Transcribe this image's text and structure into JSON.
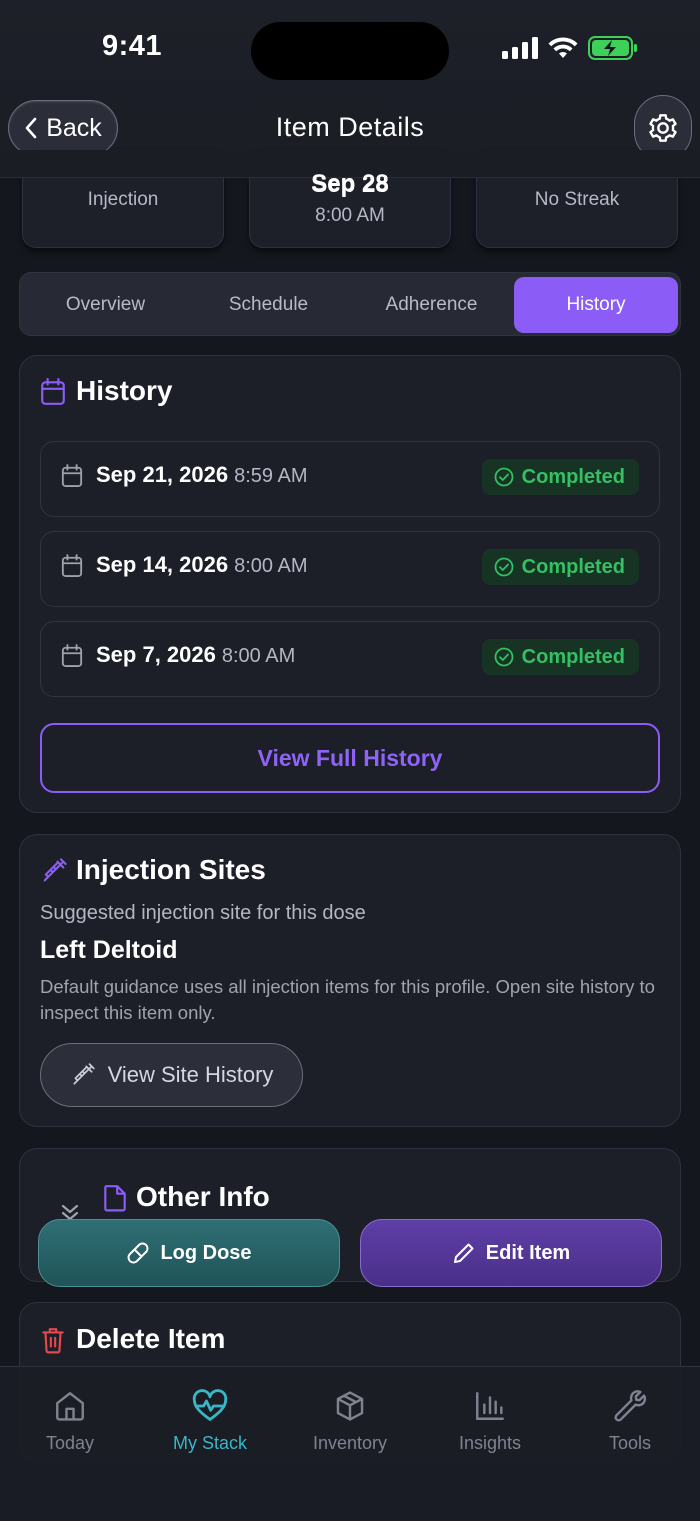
{
  "status_bar": {
    "time": "9:41"
  },
  "header": {
    "back_label": "Back",
    "title": "Item Details"
  },
  "summary": {
    "card1": "Injection",
    "card2_date": "Sep 28",
    "card2_time": "8:00 AM",
    "card3": "No Streak"
  },
  "tabs": [
    "Overview",
    "Schedule",
    "Adherence",
    "History"
  ],
  "history": {
    "title": "History",
    "rows": [
      {
        "date": "Sep 21, 2026",
        "time": "8:59 AM",
        "status": "Completed"
      },
      {
        "date": "Sep 14, 2026",
        "time": "8:00 AM",
        "status": "Completed"
      },
      {
        "date": "Sep 7, 2026",
        "time": "8:00 AM",
        "status": "Completed"
      }
    ],
    "view_full": "View Full History"
  },
  "injection_sites": {
    "title": "Injection Sites",
    "subtitle": "Suggested injection site for this dose",
    "site": "Left Deltoid",
    "description": "Default guidance uses all injection items for this profile. Open site history to inspect this item only.",
    "button": "View Site History"
  },
  "other_info": {
    "title": "Other Info"
  },
  "actions": {
    "log_dose": "Log Dose",
    "edit_item": "Edit Item"
  },
  "delete": {
    "title": "Delete Item"
  },
  "nav": [
    "Today",
    "My Stack",
    "Inventory",
    "Insights",
    "Tools"
  ],
  "colors": {
    "accent": "#8b5cf6",
    "success": "#34c063",
    "teal": "#38b7c8",
    "danger": "#e5484d"
  }
}
